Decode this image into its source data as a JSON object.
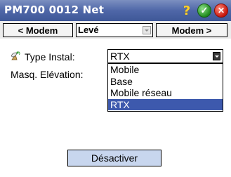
{
  "window": {
    "title": "PM700 0012 Net",
    "icons": [
      "help-icon",
      "ok-icon",
      "close-icon"
    ]
  },
  "navbar": {
    "prev_label": "< Modem",
    "mode_value": "Levé",
    "next_label": "Modem >"
  },
  "form": {
    "type_label": "Type Instal:",
    "type_icon": "satellite-antenna-icon",
    "type_value": "RTX",
    "elevation_label": "Masq. Elévation:",
    "options": [
      "Mobile",
      "Base",
      "Mobile réseau",
      "RTX"
    ],
    "selected_option": "RTX"
  },
  "footer": {
    "deactivate_label": "Désactiver"
  },
  "colors": {
    "title_bar": "#4f67a8",
    "selection": "#3d59ad",
    "button_bg": "#c8d6ee"
  }
}
